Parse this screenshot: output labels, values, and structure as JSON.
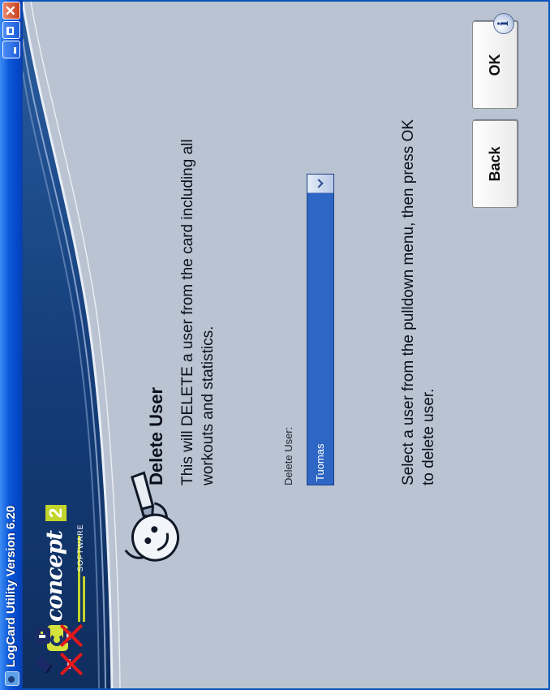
{
  "window": {
    "title": "LogCard Utility Version 6.20",
    "close_glyph": "✕"
  },
  "brand": {
    "name": "concept",
    "badge": "2",
    "tagline": "SOFTWARE"
  },
  "page": {
    "title": "Delete User",
    "description": "This will DELETE a user from the card including all workouts and statistics.",
    "instruction": "Select a user from the pulldown menu, then press OK to delete user."
  },
  "form": {
    "label": "Delete User:",
    "selected_user": "Tuomas"
  },
  "buttons": {
    "back": "Back",
    "ok": "OK"
  },
  "icons": [
    "app-icon",
    "minimize-icon",
    "maximize-icon",
    "close-icon",
    "logbook-icon",
    "card-reader-icon",
    "card-unavailable-icon",
    "device-unavailable-icon",
    "pencil-mascot-icon",
    "info-icon"
  ],
  "colors": {
    "titlebar": "#0b58d8",
    "header": "#143c78",
    "background": "#b9c3d2",
    "select": "#2d66c4"
  }
}
